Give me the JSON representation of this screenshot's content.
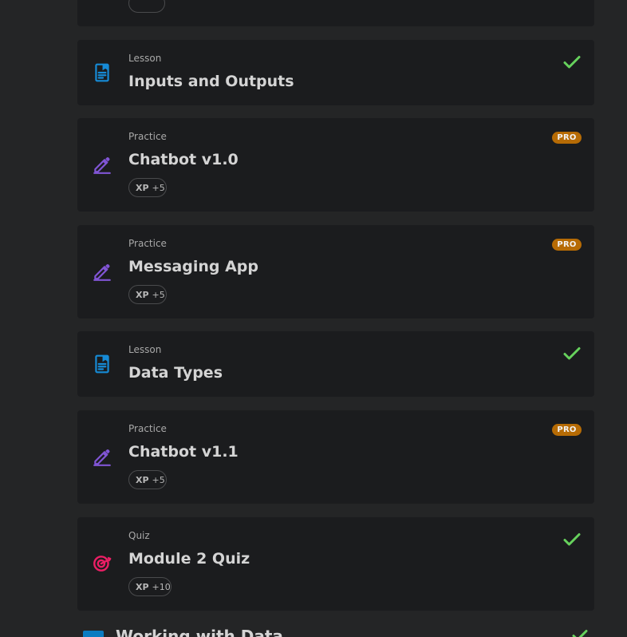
{
  "colors": {
    "page_bg": "#242526",
    "card_bg": "#1b1c1e",
    "lesson_icon": "#168bd7",
    "practice_icon": "#8155d6",
    "quiz_icon": "#ec1e65",
    "pro_badge": "#b66b05",
    "check": "#66d15c",
    "text_primary": "#d4d4d4",
    "text_secondary": "#a8a8a8"
  },
  "items": [
    {
      "type": "Lesson",
      "title": "Inputs and Outputs",
      "icon": "document-icon",
      "status": "completed"
    },
    {
      "type": "Practice",
      "title": "Chatbot v1.0",
      "icon": "pencil-icon",
      "badge": "PRO",
      "xp_label": "XP",
      "xp_value": "+5"
    },
    {
      "type": "Practice",
      "title": "Messaging App",
      "icon": "pencil-icon",
      "badge": "PRO",
      "xp_label": "XP",
      "xp_value": "+5"
    },
    {
      "type": "Lesson",
      "title": "Data Types",
      "icon": "document-icon",
      "status": "completed"
    },
    {
      "type": "Practice",
      "title": "Chatbot v1.1",
      "icon": "pencil-icon",
      "badge": "PRO",
      "xp_label": "XP",
      "xp_value": "+5"
    },
    {
      "type": "Quiz",
      "title": "Module 2 Quiz",
      "icon": "target-icon",
      "status": "completed",
      "xp_label": "XP",
      "xp_value": "+10"
    }
  ],
  "next_module": {
    "title": "Working with Data",
    "icon": "module-icon",
    "status": "completed"
  }
}
